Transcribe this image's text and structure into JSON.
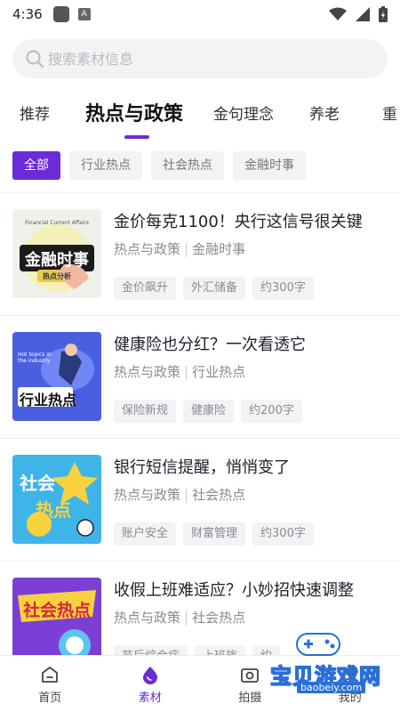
{
  "status_bar": {
    "time": "4:36"
  },
  "search": {
    "placeholder": "搜索素材信息"
  },
  "tabs": [
    {
      "label": "推荐"
    },
    {
      "label": "热点与政策"
    },
    {
      "label": "金句理念"
    },
    {
      "label": "养老"
    },
    {
      "label": "重"
    }
  ],
  "filters": [
    {
      "label": "全部"
    },
    {
      "label": "行业热点"
    },
    {
      "label": "社会热点"
    },
    {
      "label": "金融时事"
    }
  ],
  "feed": [
    {
      "title": "金价每克1100！央行这信号很关键",
      "category": "热点与政策",
      "subcategory": "金融时事",
      "tags": [
        "金价飙升",
        "外汇储备",
        "约300字"
      ],
      "thumb_caption": "金融时事",
      "thumb_sub": "热点分析",
      "thumb_top": "Financial Current Affairs"
    },
    {
      "title": "健康险也分红？一次看透它",
      "category": "热点与政策",
      "subcategory": "行业热点",
      "tags": [
        "保险新规",
        "健康险",
        "约200字"
      ],
      "thumb_caption": "行业热点",
      "thumb_top": "Hot topics in the industry"
    },
    {
      "title": "银行短信提醒，悄悄变了",
      "category": "热点与政策",
      "subcategory": "社会热点",
      "tags": [
        "账户安全",
        "财富管理",
        "约300字"
      ],
      "thumb_caption": "社会",
      "thumb_caption2": "热点"
    },
    {
      "title": "收假上班难适应？小妙招快速调整",
      "category": "热点与政策",
      "subcategory": "社会热点",
      "tags": [
        "节后综合症",
        "上班族",
        "约"
      ],
      "thumb_caption": "社会热点"
    }
  ],
  "bottom_nav": [
    {
      "label": "首页",
      "icon": "home-icon"
    },
    {
      "label": "素材",
      "icon": "material-drop-icon"
    },
    {
      "label": "拍摄",
      "icon": "camera-icon"
    },
    {
      "label": "我的",
      "icon": "profile-icon"
    }
  ],
  "watermark": {
    "text": "宝贝游戏网",
    "url": "baobeiy.com"
  },
  "colors": {
    "accent": "#6c2bd9",
    "chip_bg": "#f3f3f5",
    "meta_text": "#8a8a95"
  }
}
